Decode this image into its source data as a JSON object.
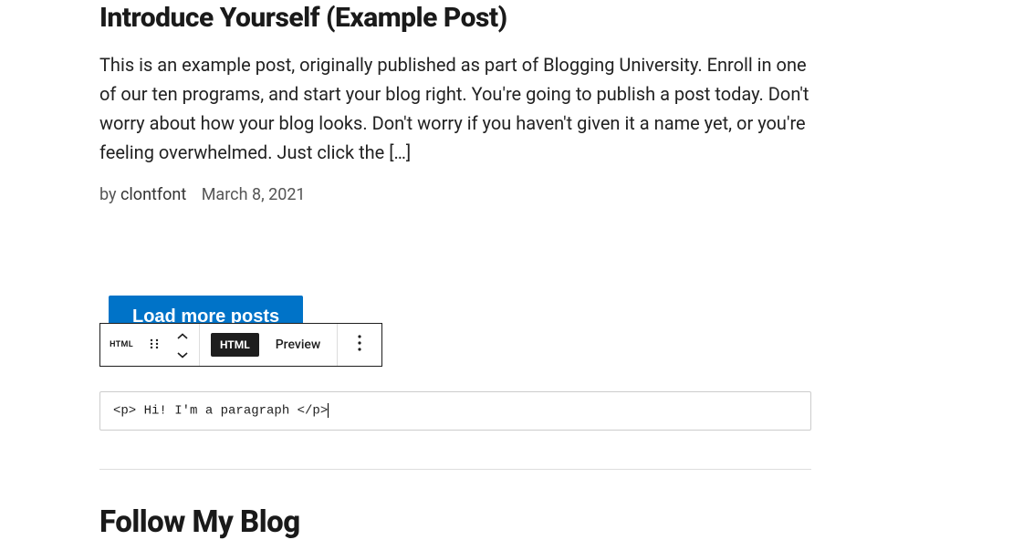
{
  "post": {
    "title": "Introduce Yourself (Example Post)",
    "excerpt": "This is an example post, originally published as part of Blogging University. Enroll in one of our ten programs, and start your blog right. You're going to publish a post today. Don't worry about how your blog looks. Don't worry if you haven't given it a name yet, or you're feeling overwhelmed. Just click the […]",
    "by_prefix": "by ",
    "author": "clontfont",
    "date": "March 8, 2021"
  },
  "load_more": {
    "label": "Load more posts"
  },
  "toolbar": {
    "block_type": "HTML",
    "html_tab": "HTML",
    "preview_tab": "Preview"
  },
  "code_block": {
    "value": "<p> Hi! I'm a paragraph </p>"
  },
  "follow": {
    "heading": "Follow My Blog"
  }
}
